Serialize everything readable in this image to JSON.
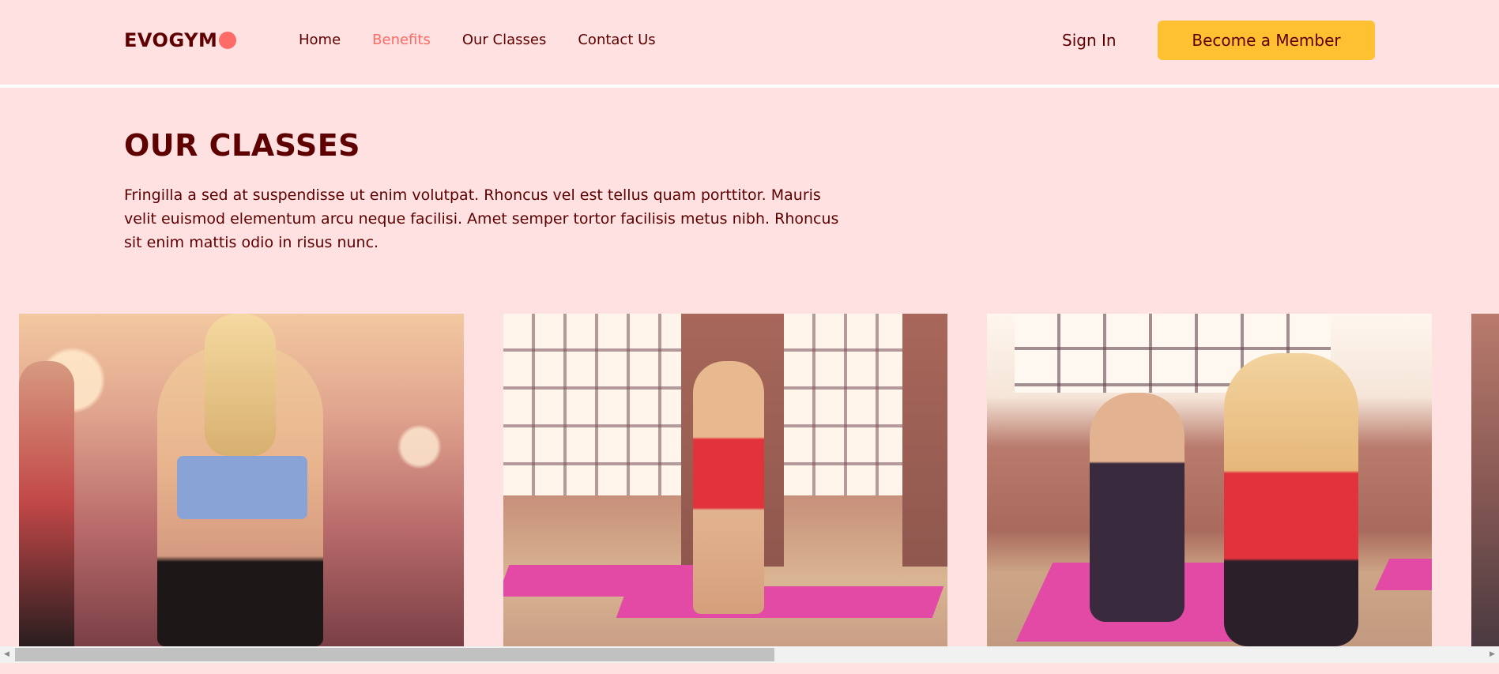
{
  "header": {
    "logo_text": "EVOGYM",
    "nav": [
      {
        "label": "Home",
        "active": false
      },
      {
        "label": "Benefits",
        "active": true
      },
      {
        "label": "Our Classes",
        "active": false
      },
      {
        "label": "Contact Us",
        "active": false
      }
    ],
    "sign_in_label": "Sign In",
    "cta_label": "Become a Member"
  },
  "classes": {
    "title": "OUR CLASSES",
    "description": "Fringilla a sed at suspendisse ut enim volutpat. Rhoncus vel est tellus quam porttitor. Mauris velit euismod elementum arcu neque facilisi. Amet semper tortor facilisis metus nibh. Rhoncus sit enim mattis odio in risus nunc."
  },
  "theme": {
    "background": "#ffe1e1",
    "primary_text": "#5e0000",
    "accent": "#ff6b66",
    "cta_background": "#ffc132"
  },
  "icons": {
    "logo_dot": "circle-dot-icon",
    "scroll_left": "scroll-left-icon",
    "scroll_right": "scroll-right-icon"
  },
  "scroll_arrows": {
    "left": "◀",
    "right": "▶"
  }
}
